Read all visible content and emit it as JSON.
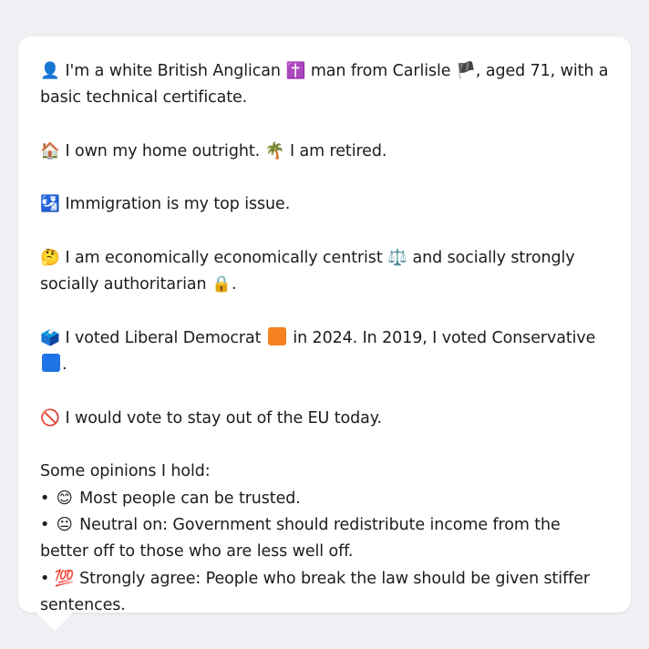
{
  "profile": {
    "intro": {
      "icon": "👤",
      "text_a": "I'm a white British Anglican",
      "icon2": "✝️",
      "text_b": "man from Carlisle",
      "flag": "🏴",
      "text_c": ", aged 71, with a basic technical certificate."
    },
    "home": {
      "icon": "🏠",
      "text_a": "I own my home outright.",
      "icon2": "🌴",
      "text_b": "I am retired."
    },
    "issue": {
      "icon": "🛂",
      "text": "Immigration is my top issue."
    },
    "ideology": {
      "icon": "🤔",
      "text_a": "I am economically economically centrist",
      "icon2": "⚖️",
      "text_b": "and socially strongly socially authoritarian",
      "icon3": "🔒",
      "text_c": "."
    },
    "votes": {
      "icon": "🗳️",
      "text_a": "I voted Liberal Democrat",
      "color_a": "#f5821f",
      "text_b": "in 2024. In 2019, I voted Conservative",
      "color_b": "#1e74e6",
      "text_c": "."
    },
    "eu": {
      "icon": "🚫",
      "text": "I would vote to stay out of the EU today."
    },
    "opinions": {
      "heading": "Some opinions I hold:",
      "bullet": "•",
      "items": [
        {
          "icon": "😊",
          "text": "Most people can be trusted."
        },
        {
          "icon": "😐",
          "text": "Neutral on: Government should redistribute income from the better off to those who are less well off."
        },
        {
          "icon": "💯",
          "text": "Strongly agree: People who break the law should be given stiffer sentences."
        }
      ]
    }
  }
}
